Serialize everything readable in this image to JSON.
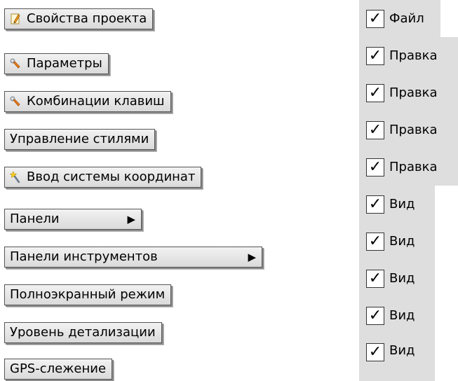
{
  "menu": {
    "items": [
      {
        "label": "Свойства проекта",
        "icon": "pencil-icon",
        "submenu": false
      },
      {
        "label": "Параметры",
        "icon": "wrench-icon",
        "submenu": false
      },
      {
        "label": "Комбинации клавиш",
        "icon": "wrench-icon",
        "submenu": false
      },
      {
        "label": "Управление стилями",
        "icon": "",
        "submenu": false
      },
      {
        "label": "Ввод системы координат",
        "icon": "magic-wand-icon",
        "submenu": false
      },
      {
        "label": "Панели",
        "icon": "",
        "submenu": true,
        "arrow": "▶"
      },
      {
        "label": "Панели инструментов",
        "icon": "",
        "submenu": true,
        "arrow": "▶"
      },
      {
        "label": "Полноэкранный режим",
        "icon": "",
        "submenu": false
      },
      {
        "label": "Уровень детализации",
        "icon": "",
        "submenu": false
      },
      {
        "label": "GPS-слежение",
        "icon": "",
        "submenu": false
      }
    ]
  },
  "checklist": {
    "check_glyph": "✓",
    "items": [
      {
        "label": "Файл",
        "checked": true
      },
      {
        "label": "Правка",
        "checked": true
      },
      {
        "label": "Правка",
        "checked": true
      },
      {
        "label": "Правка",
        "checked": true
      },
      {
        "label": "Правка",
        "checked": true
      },
      {
        "label": "Вид",
        "checked": true
      },
      {
        "label": "Вид",
        "checked": true
      },
      {
        "label": "Вид",
        "checked": true
      },
      {
        "label": "Вид",
        "checked": true
      },
      {
        "label": "Вид",
        "checked": true
      }
    ]
  },
  "colors": {
    "button_border": "#555555",
    "checklist_background": "#dedede"
  }
}
